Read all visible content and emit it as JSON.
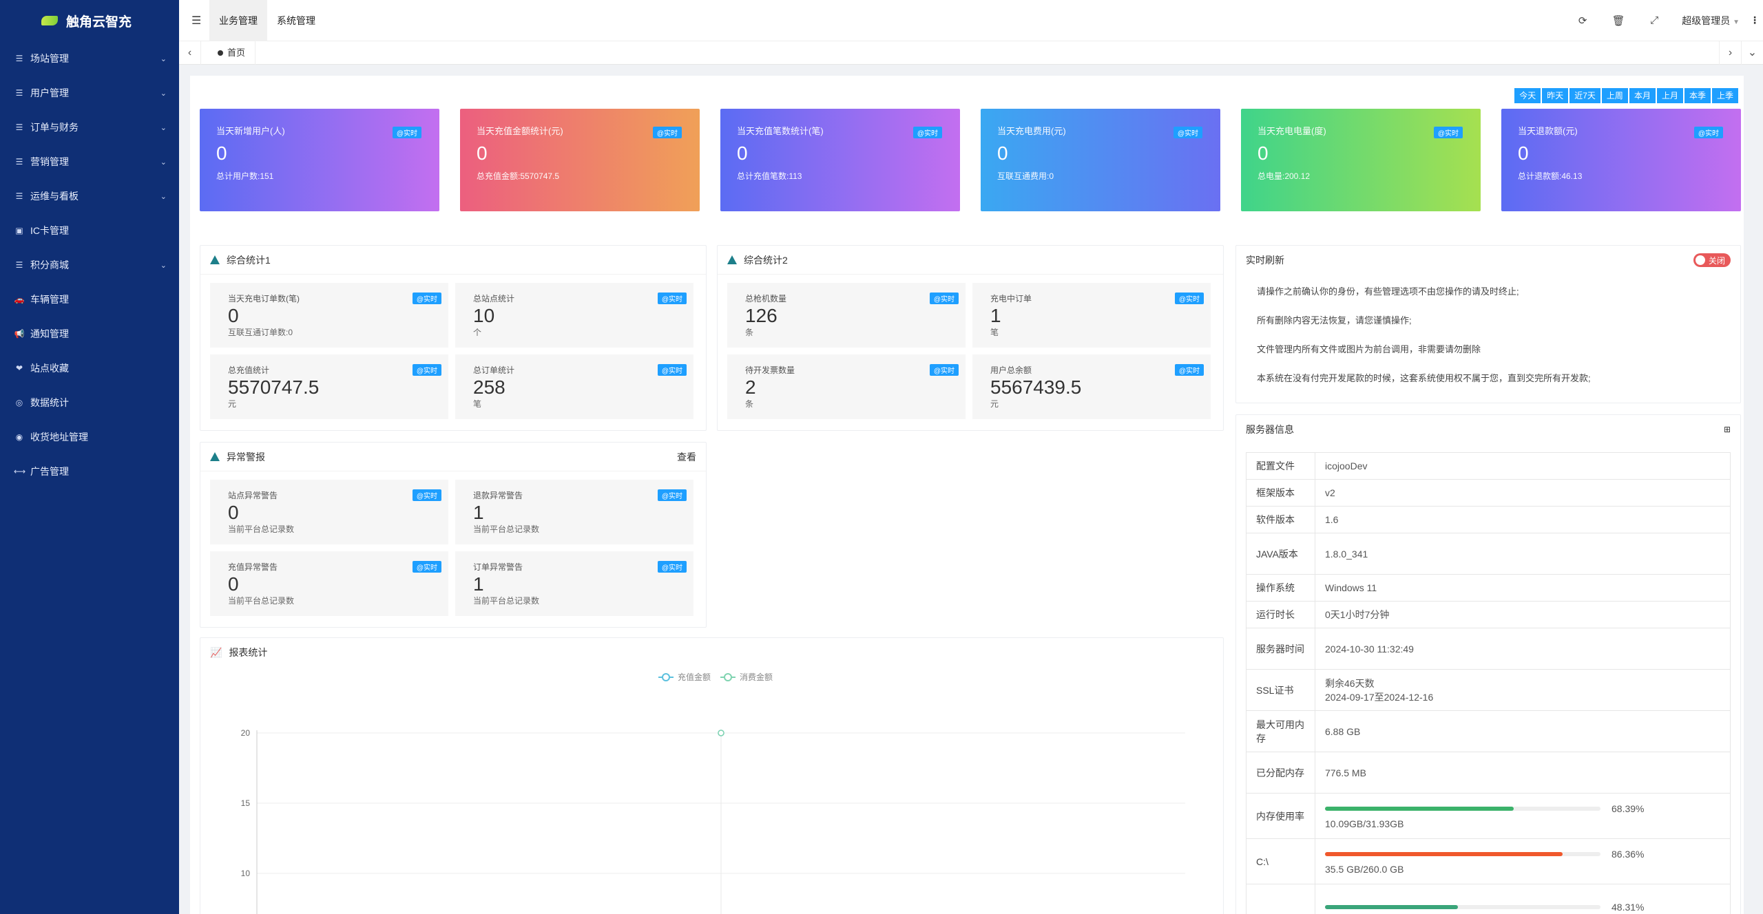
{
  "app": {
    "title": "触角云智充"
  },
  "sidebar": {
    "items": [
      {
        "label": "场站管理",
        "icon": "list-icon",
        "has_children": true
      },
      {
        "label": "用户管理",
        "icon": "list-icon",
        "has_children": true
      },
      {
        "label": "订单与财务",
        "icon": "list-icon",
        "has_children": true
      },
      {
        "label": "营销管理",
        "icon": "list-icon",
        "has_children": true
      },
      {
        "label": "运维与看板",
        "icon": "list-icon",
        "has_children": true
      },
      {
        "label": "IC卡管理",
        "icon": "card-icon",
        "has_children": false
      },
      {
        "label": "积分商城",
        "icon": "list-icon",
        "has_children": true
      },
      {
        "label": "车辆管理",
        "icon": "car-icon",
        "has_children": false
      },
      {
        "label": "通知管理",
        "icon": "megaphone-icon",
        "has_children": false
      },
      {
        "label": "站点收藏",
        "icon": "heart-icon",
        "has_children": false
      },
      {
        "label": "数据统计",
        "icon": "chart-icon",
        "has_children": false
      },
      {
        "label": "收货地址管理",
        "icon": "location-icon",
        "has_children": false
      },
      {
        "label": "广告管理",
        "icon": "ad-icon",
        "has_children": false
      }
    ]
  },
  "topbar": {
    "tabs": [
      {
        "label": "业务管理",
        "active": true
      },
      {
        "label": "系统管理",
        "active": false
      }
    ],
    "icons": [
      "refresh-icon",
      "trash-icon",
      "fullscreen-icon"
    ],
    "user": "超级管理员"
  },
  "tabbar": {
    "home": "首页"
  },
  "range_buttons": [
    "今天",
    "昨天",
    "近7天",
    "上周",
    "本月",
    "上月",
    "本季",
    "上季"
  ],
  "stat_cards": [
    {
      "title": "当天新增用户(人)",
      "value": "0",
      "sub": "总计用户数:151",
      "badge": "@实时",
      "gradient": [
        "#5b6cf3",
        "#c36ff0"
      ]
    },
    {
      "title": "当天充值金额统计(元)",
      "value": "0",
      "sub": "总充值金额:5570747.5",
      "badge": "@实时",
      "gradient": [
        "#ec5f7f",
        "#f0a058"
      ]
    },
    {
      "title": "当天充值笔数统计(笔)",
      "value": "0",
      "sub": "总计充值笔数:113",
      "badge": "@实时",
      "gradient": [
        "#5b6cf3",
        "#c36ff0"
      ]
    },
    {
      "title": "当天充电费用(元)",
      "value": "0",
      "sub": "互联互通费用:0",
      "badge": "@实时",
      "gradient": [
        "#3aa8f2",
        "#6a70f2"
      ]
    },
    {
      "title": "当天充电电量(度)",
      "value": "0",
      "sub": "总电量:200.12",
      "badge": "@实时",
      "gradient": [
        "#3fd48a",
        "#a6e050"
      ]
    },
    {
      "title": "当天退款额(元)",
      "value": "0",
      "sub": "总计退款额:46.13",
      "badge": "@实时",
      "gradient": [
        "#5b6cf3",
        "#c36ff0"
      ]
    }
  ],
  "panel1": {
    "title": "综合统计1",
    "items": [
      {
        "title": "当天充电订单数(笔)",
        "value": "0",
        "unit": "互联互通订单数:0",
        "badge": "@实时"
      },
      {
        "title": "总站点统计",
        "value": "10",
        "unit": "个",
        "badge": "@实时"
      },
      {
        "title": "总充值统计",
        "value": "5570747.5",
        "unit": "元",
        "badge": "@实时"
      },
      {
        "title": "总订单统计",
        "value": "258",
        "unit": "笔",
        "badge": "@实时"
      }
    ]
  },
  "panel2": {
    "title": "综合统计2",
    "items": [
      {
        "title": "总枪机数量",
        "value": "126",
        "unit": "条",
        "badge": "@实时"
      },
      {
        "title": "充电中订单",
        "value": "1",
        "unit": "笔",
        "badge": "@实时"
      },
      {
        "title": "待开发票数量",
        "value": "2",
        "unit": "条",
        "badge": "@实时"
      },
      {
        "title": "用户总余额",
        "value": "5567439.5",
        "unit": "元",
        "badge": "@实时"
      }
    ]
  },
  "panel3": {
    "title": "异常警报",
    "link": "查看",
    "items": [
      {
        "title": "站点异常警告",
        "value": "0",
        "unit": "当前平台总记录数",
        "badge": "@实时"
      },
      {
        "title": "退款异常警告",
        "value": "1",
        "unit": "当前平台总记录数",
        "badge": "@实时"
      },
      {
        "title": "充值异常警告",
        "value": "0",
        "unit": "当前平台总记录数",
        "badge": "@实时"
      },
      {
        "title": "订单异常警告",
        "value": "1",
        "unit": "当前平台总记录数",
        "badge": "@实时"
      }
    ]
  },
  "realtime": {
    "title": "实时刷新",
    "toggle_label": "关闭",
    "notices": [
      "请操作之前确认你的身份，有些管理选项不由您操作的请及时终止;",
      "所有删除内容无法恢复，请您谨慎操作;",
      "文件管理内所有文件或图片为前台调用，非需要请勿删除",
      "本系统在没有付完开发尾款的时候，这套系统使用权不属于您，直到交完所有开发款;"
    ]
  },
  "server": {
    "title": "服务器信息",
    "rows": [
      {
        "key": "配置文件",
        "value": "icojooDev"
      },
      {
        "key": "框架版本",
        "value": "v2"
      },
      {
        "key": "软件版本",
        "value": "1.6"
      },
      {
        "key": "JAVA版本",
        "value": "1.8.0_341"
      },
      {
        "key": "操作系统",
        "value": "Windows 11"
      },
      {
        "key": "运行时长",
        "value": "0天1小时7分钟"
      },
      {
        "key": "服务器时间",
        "value": "2024-10-30 11:32:49"
      },
      {
        "key": "SSL证书",
        "value": "剩余46天数",
        "value2": "2024-09-17至2024-12-16"
      },
      {
        "key": "最大可用内存",
        "value": "6.88 GB"
      },
      {
        "key": "已分配内存",
        "value": "776.5 MB"
      }
    ],
    "usage": [
      {
        "key": "内存使用率",
        "pct": "68.39%",
        "fraction": 0.6839,
        "detail": "10.09GB/31.93GB",
        "color": "#3bb26a"
      },
      {
        "key": "C:\\",
        "pct": "86.36%",
        "fraction": 0.8636,
        "detail": "35.5 GB/260.0 GB",
        "color": "#f0582c"
      },
      {
        "key": "",
        "pct": "48.31%",
        "fraction": 0.4831,
        "detail": "",
        "color": "#3aa57a"
      }
    ]
  },
  "report": {
    "title": "报表统计"
  },
  "chart_data": {
    "type": "line",
    "series": [
      {
        "name": "充值金额",
        "color": "#5bc0de",
        "values": [
          20
        ]
      },
      {
        "name": "消费金额",
        "color": "#7fd3b0",
        "values": [
          20
        ]
      }
    ],
    "categories": [
      ""
    ],
    "yticks": [
      "20",
      "15",
      "10"
    ],
    "ylim": [
      10,
      20
    ],
    "grid": true,
    "legend": "top-center"
  }
}
